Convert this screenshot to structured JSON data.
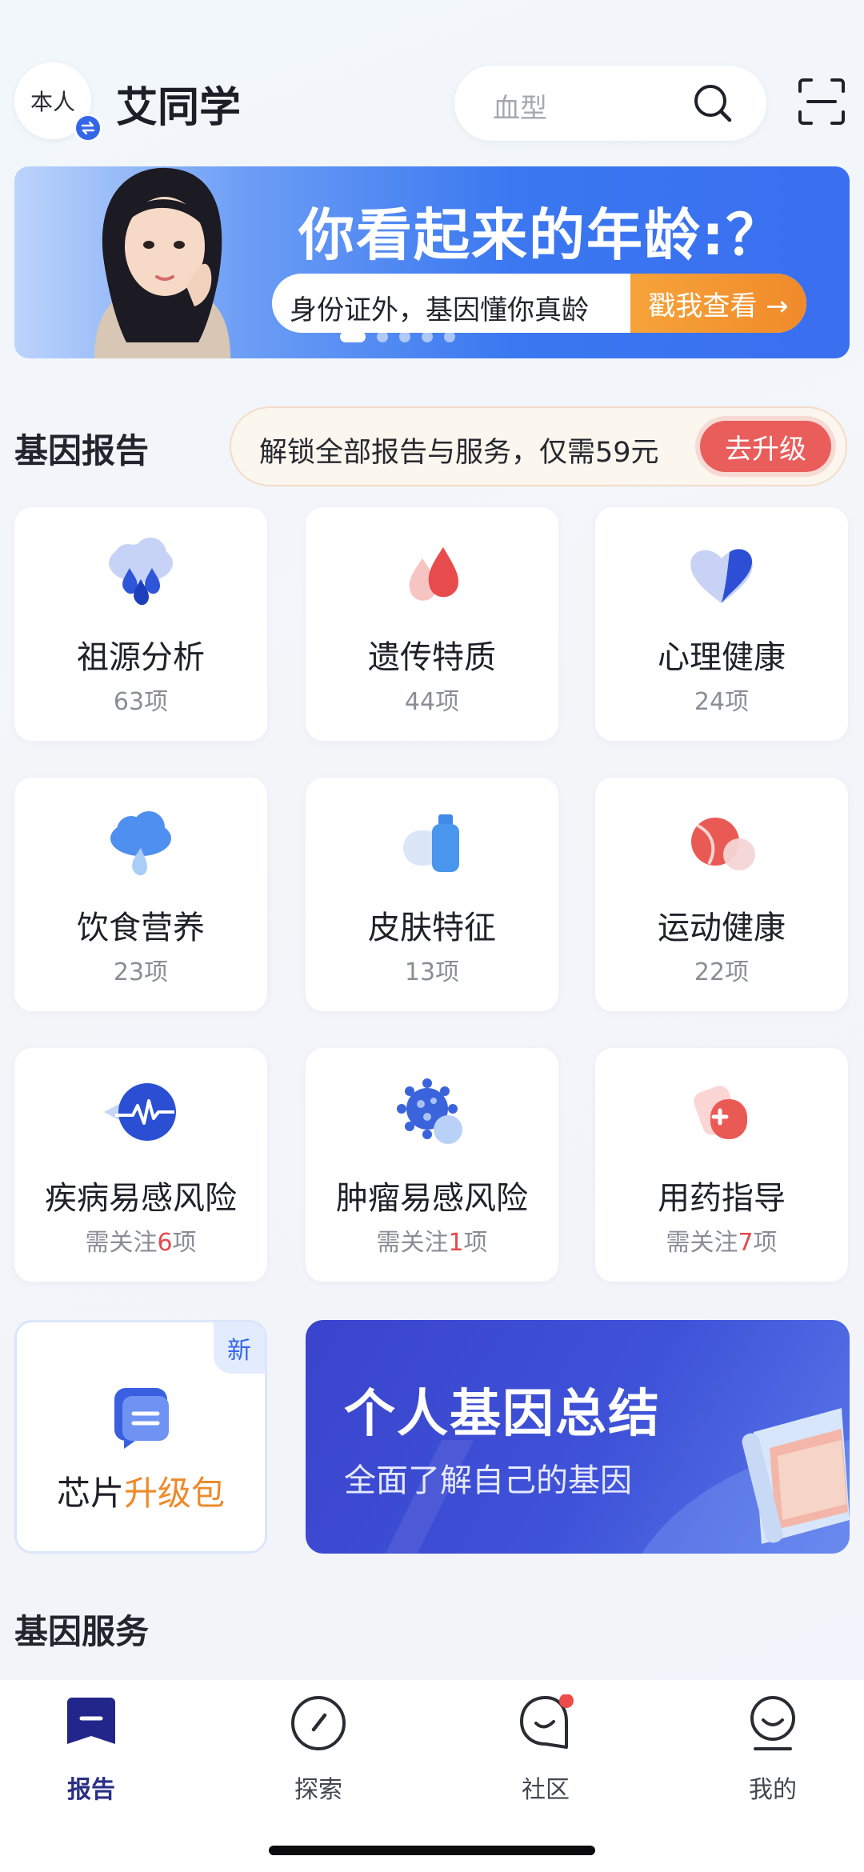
{
  "header": {
    "avatar_label": "本人",
    "user_name": "艾同学",
    "search_placeholder": "血型"
  },
  "banner": {
    "title": "你看起来的年龄:？",
    "subtitle": "身份证外，基因懂你真龄",
    "cta": "戳我查看 →",
    "slides": 5,
    "active_slide": 1
  },
  "reports": {
    "section_title": "基因报告",
    "upgrade_text": "解锁全部报告与服务，仅需59元",
    "upgrade_button": "去升级",
    "cards": [
      {
        "name": "祖源分析",
        "count": "63项",
        "icon": "cloud-drops-icon"
      },
      {
        "name": "遗传特质",
        "count": "44项",
        "icon": "double-drop-icon"
      },
      {
        "name": "心理健康",
        "count": "24项",
        "icon": "heart-icon"
      },
      {
        "name": "饮食营养",
        "count": "23项",
        "icon": "cloud-drop-icon"
      },
      {
        "name": "皮肤特征",
        "count": "13项",
        "icon": "bottle-icon"
      },
      {
        "name": "运动健康",
        "count": "22项",
        "icon": "ball-icon"
      },
      {
        "name": "疾病易感风险",
        "count_prefix": "需关注",
        "count_num": "6",
        "count_suffix": "项",
        "icon": "pulse-icon"
      },
      {
        "name": "肿瘤易感风险",
        "count_prefix": "需关注",
        "count_num": "1",
        "count_suffix": "项",
        "icon": "virus-icon"
      },
      {
        "name": "用药指导",
        "count_prefix": "需关注",
        "count_num": "7",
        "count_suffix": "项",
        "icon": "pill-icon"
      }
    ],
    "chip": {
      "tag": "新",
      "name_prefix": "芯片",
      "name_highlight": "升级包"
    },
    "summary": {
      "title": "个人基因总结",
      "subtitle": "全面了解自己的基因"
    }
  },
  "services": {
    "section_title": "基因服务"
  },
  "tabbar": {
    "items": [
      {
        "label": "报告",
        "active": true
      },
      {
        "label": "探索",
        "active": false
      },
      {
        "label": "社区",
        "active": false,
        "badge": true
      },
      {
        "label": "我的",
        "active": false
      }
    ]
  },
  "colors": {
    "accent": "#3466e8",
    "orange": "#f08a2a",
    "red": "#e4494d",
    "nav_active": "#2b2f86"
  }
}
